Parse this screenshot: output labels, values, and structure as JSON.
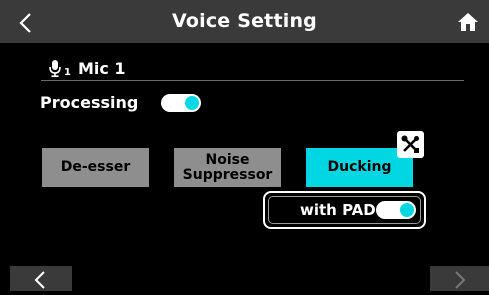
{
  "header": {
    "title": "Voice Setting",
    "back_icon": "chevron-left-icon",
    "home_icon": "home-icon"
  },
  "mic": {
    "icon": "microphone-icon",
    "number": "1",
    "label": "Mic 1"
  },
  "processing": {
    "label": "Processing",
    "enabled": true
  },
  "buttons": {
    "de_esser": "De-esser",
    "noise_suppressor_line1": "Noise",
    "noise_suppressor_line2": "Suppressor",
    "ducking": "Ducking"
  },
  "ducking_settings_icon": "tools-icon",
  "pad": {
    "label": "with PAD",
    "enabled": true
  },
  "footer": {
    "prev_icon": "chevron-left-icon",
    "next_icon": "chevron-right-icon"
  },
  "colors": {
    "accent": "#00d7e3",
    "header": "#3a3a3a",
    "button_gray": "#8e8e8e"
  }
}
